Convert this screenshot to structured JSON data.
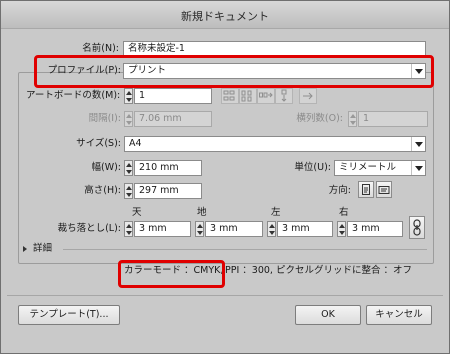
{
  "window": {
    "title": "新規ドキュメント"
  },
  "name": {
    "label": "名前(N):",
    "value": "名称未設定-1"
  },
  "profile": {
    "label": "プロファイル(P):",
    "value": "プリント"
  },
  "artboards": {
    "label": "アートボードの数(M):",
    "value": "1"
  },
  "spacing": {
    "label": "間隔(I):",
    "value": "7.06 mm"
  },
  "columns": {
    "label": "横列数(O):",
    "value": "1"
  },
  "size": {
    "label": "サイズ(S):",
    "value": "A4"
  },
  "width": {
    "label": "幅(W):",
    "value": "210 mm"
  },
  "units": {
    "label": "単位(U):",
    "value": "ミリメートル"
  },
  "height": {
    "label": "高さ(H):",
    "value": "297 mm"
  },
  "orientation": {
    "label": "方向:"
  },
  "bleed": {
    "label": "裁ち落とし(L):",
    "top_label": "天",
    "bottom_label": "地",
    "left_label": "左",
    "right_label": "右",
    "top": "3 mm",
    "bottom": "3 mm",
    "left": "3 mm",
    "right": "3 mm"
  },
  "advanced": {
    "label": "詳細"
  },
  "info": {
    "color_mode": "カラーモード ：CMYK,",
    "rest": "PPI ：300, ピクセルグリッドに整合 ：オフ"
  },
  "buttons": {
    "templates": "テンプレート(T)...",
    "ok": "OK",
    "cancel": "キャンセル"
  },
  "colors": {
    "highlight": "#e00000",
    "dialog_bg": "#c9c9c9"
  }
}
